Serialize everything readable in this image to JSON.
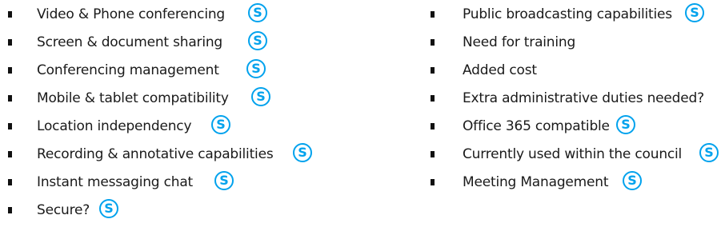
{
  "icon": {
    "name": "skype-icon",
    "color": "#00a2ed"
  },
  "left_column": [
    {
      "label": "Video & Phone conferencing",
      "has_icon": true
    },
    {
      "label": "Screen & document sharing",
      "has_icon": true
    },
    {
      "label": "Conferencing management",
      "has_icon": true
    },
    {
      "label": "Mobile & tablet compatibility",
      "has_icon": true
    },
    {
      "label": "Location independency",
      "has_icon": true
    },
    {
      "label": "Recording & annotative capabilities",
      "has_icon": true
    },
    {
      "label": "Instant messaging chat",
      "has_icon": true
    },
    {
      "label": "Secure?",
      "has_icon": true
    }
  ],
  "right_column": [
    {
      "label": "Public broadcasting capabilities",
      "has_icon": true
    },
    {
      "label": "Need for training",
      "has_icon": false
    },
    {
      "label": "Added cost",
      "has_icon": false
    },
    {
      "label": "Extra administrative duties needed?",
      "has_icon": false
    },
    {
      "label": "Office 365 compatible",
      "has_icon": true
    },
    {
      "label": "Currently used within the council",
      "has_icon": true
    },
    {
      "label": "Meeting Management",
      "has_icon": true
    }
  ]
}
